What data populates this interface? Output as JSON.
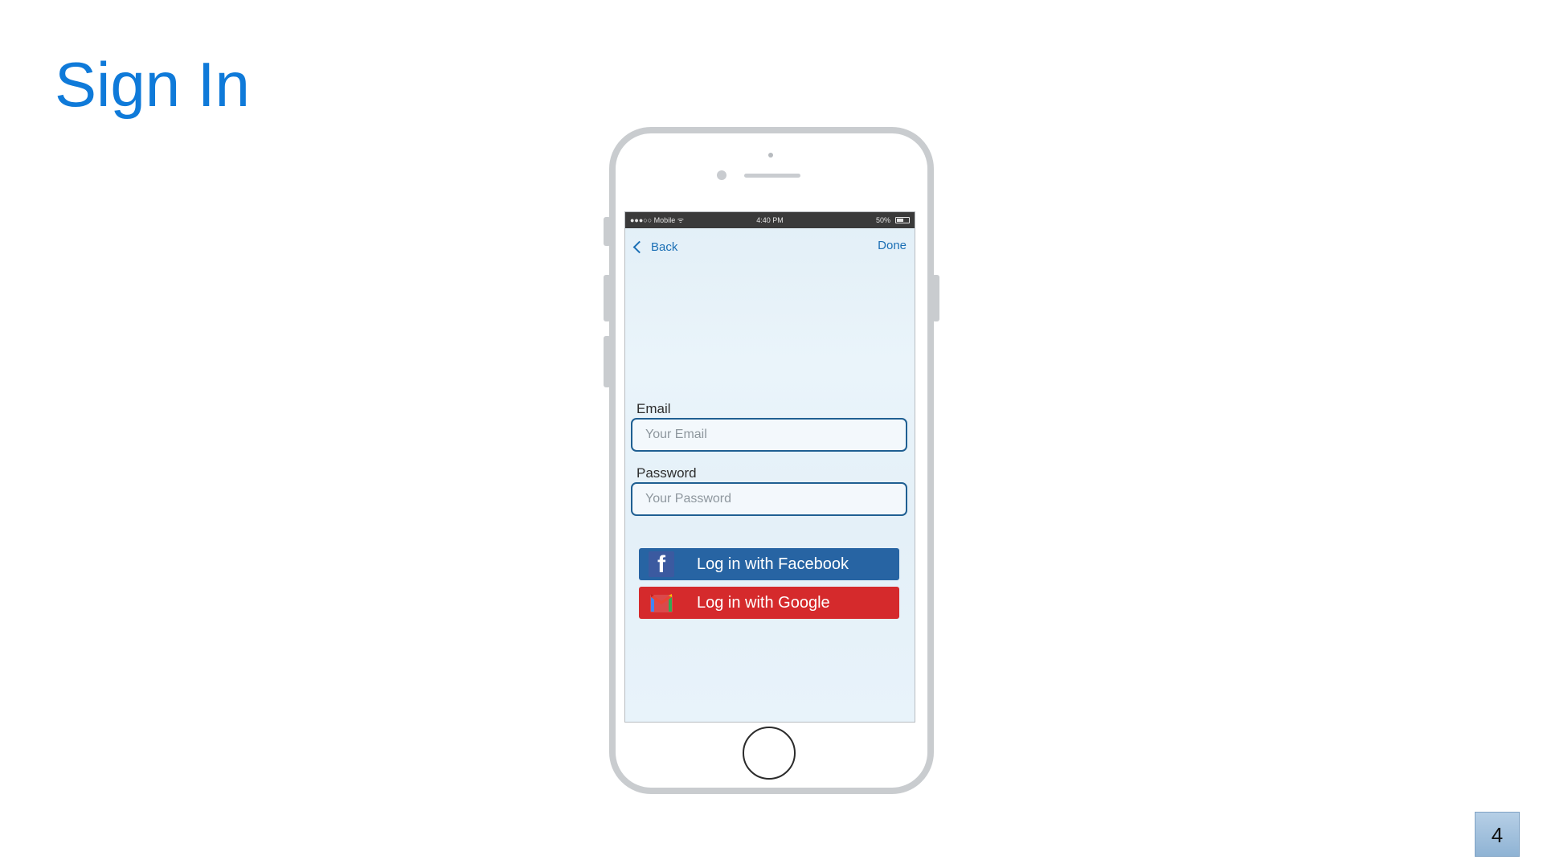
{
  "slide": {
    "title": "Sign In",
    "page_number": "4"
  },
  "status_bar": {
    "carrier": "●●●○○ Mobile ᯤ",
    "time": "4:40 PM",
    "battery": "50%"
  },
  "nav": {
    "back_label": "Back",
    "done_label": "Done"
  },
  "form": {
    "email_label": "Email",
    "email_placeholder": "Your Email",
    "email_value": "",
    "password_label": "Password",
    "password_placeholder": "Your Password",
    "password_value": ""
  },
  "buttons": {
    "facebook_label": "Log in with Facebook",
    "google_label": "Log in with Google"
  },
  "colors": {
    "title": "#0f7ad9",
    "facebook": "#2764a3",
    "google": "#d52a2c",
    "link": "#1b6fb5"
  },
  "icons": {
    "back": "chevron-left-icon",
    "facebook": "facebook-icon",
    "google": "gmail-icon",
    "battery": "battery-icon"
  }
}
